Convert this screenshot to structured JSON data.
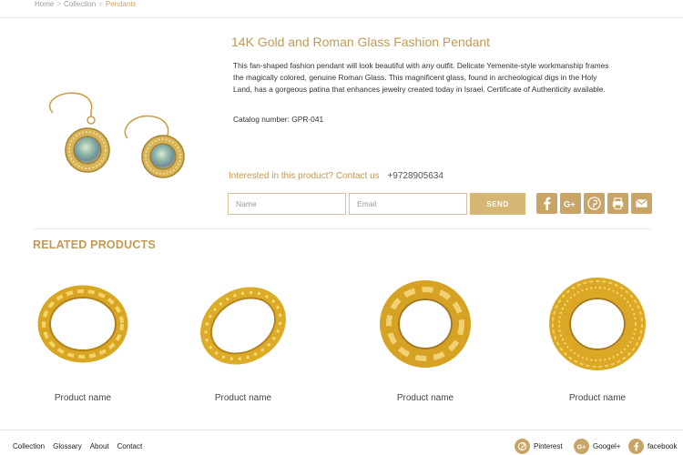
{
  "breadcrumb": {
    "home": "Home",
    "collection": "Collection",
    "current": "Pendants",
    "separator": ">"
  },
  "product": {
    "title": "14K Gold and Roman Glass Fashion Pendant",
    "description": "This fan-shaped fashion pendant will look beautiful with any outfit. Delicate Yemenite-style workmanship frames the magically colored, genuine Roman Glass. This magnificent glass, found in archeological digs in the Holy Land, has a gorgeous patina that enhances jewelry created today in Israel. Certificate of Authenticity available.",
    "catalog": "Catalog number: GPR-041"
  },
  "contact": {
    "question": "Interested in this product? Contact us",
    "phone": "+9728905634",
    "name_placeholder": "Name",
    "email_placeholder": "Email",
    "send_label": "SEND"
  },
  "share_icons": [
    "facebook-icon",
    "google-plus-icon",
    "pinterest-icon",
    "print-icon",
    "mail-icon"
  ],
  "related": {
    "title": "RELATED PRODUCTS",
    "items": [
      {
        "name": "Product name"
      },
      {
        "name": "Product name"
      },
      {
        "name": "Product name"
      },
      {
        "name": "Product name"
      }
    ]
  },
  "footer": {
    "links": [
      "Collection",
      "Glossary",
      "About",
      "Contact"
    ],
    "social": [
      {
        "label": "Pinterest",
        "icon": "pinterest-icon"
      },
      {
        "label": "Googel+",
        "icon": "google-plus-icon"
      },
      {
        "label": "facebook",
        "icon": "facebook-icon"
      }
    ]
  },
  "colors": {
    "accent": "#c29a55",
    "button": "#d6b675",
    "gold": "#d4a326"
  }
}
